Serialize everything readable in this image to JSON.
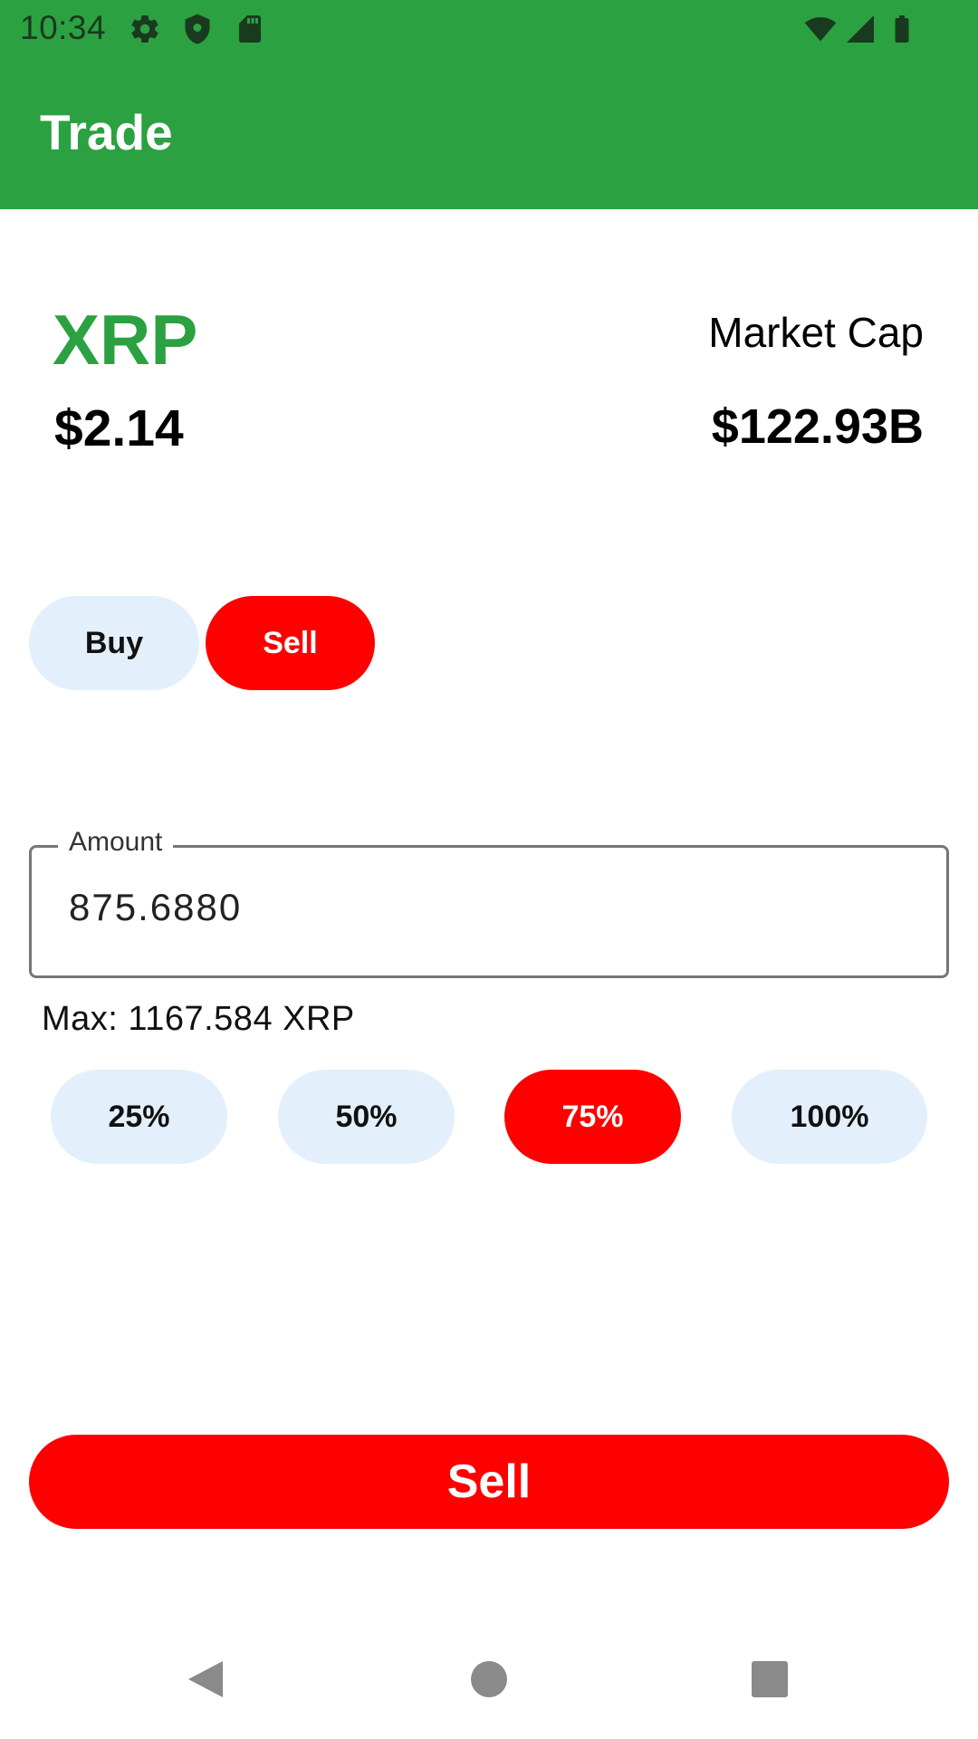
{
  "status_bar": {
    "time": "10:34",
    "left_icons": [
      "gear-icon",
      "shield-icon",
      "sd-card-icon"
    ],
    "right_icons": [
      "wifi-icon",
      "signal-icon",
      "battery-icon"
    ]
  },
  "app_bar": {
    "title": "Trade"
  },
  "coin": {
    "symbol": "XRP",
    "price": "$2.14",
    "market_cap_label": "Market Cap",
    "market_cap_value": "$122.93B"
  },
  "trade_toggle": {
    "buy_label": "Buy",
    "sell_label": "Sell",
    "selected": "Sell"
  },
  "amount": {
    "label": "Amount",
    "value": "875.6880",
    "max_text": "Max: 1167.584 XRP"
  },
  "percent_options": {
    "p25": "25%",
    "p50": "50%",
    "p75": "75%",
    "p100": "100%",
    "selected": "75%"
  },
  "action": {
    "label": "Sell"
  },
  "nav_bar": {
    "icons": [
      "back-icon",
      "home-icon",
      "recents-icon"
    ]
  },
  "colors": {
    "brand_green": "#2ba142",
    "sell_red": "#ff0000",
    "chip_light": "#e3f0fb"
  }
}
